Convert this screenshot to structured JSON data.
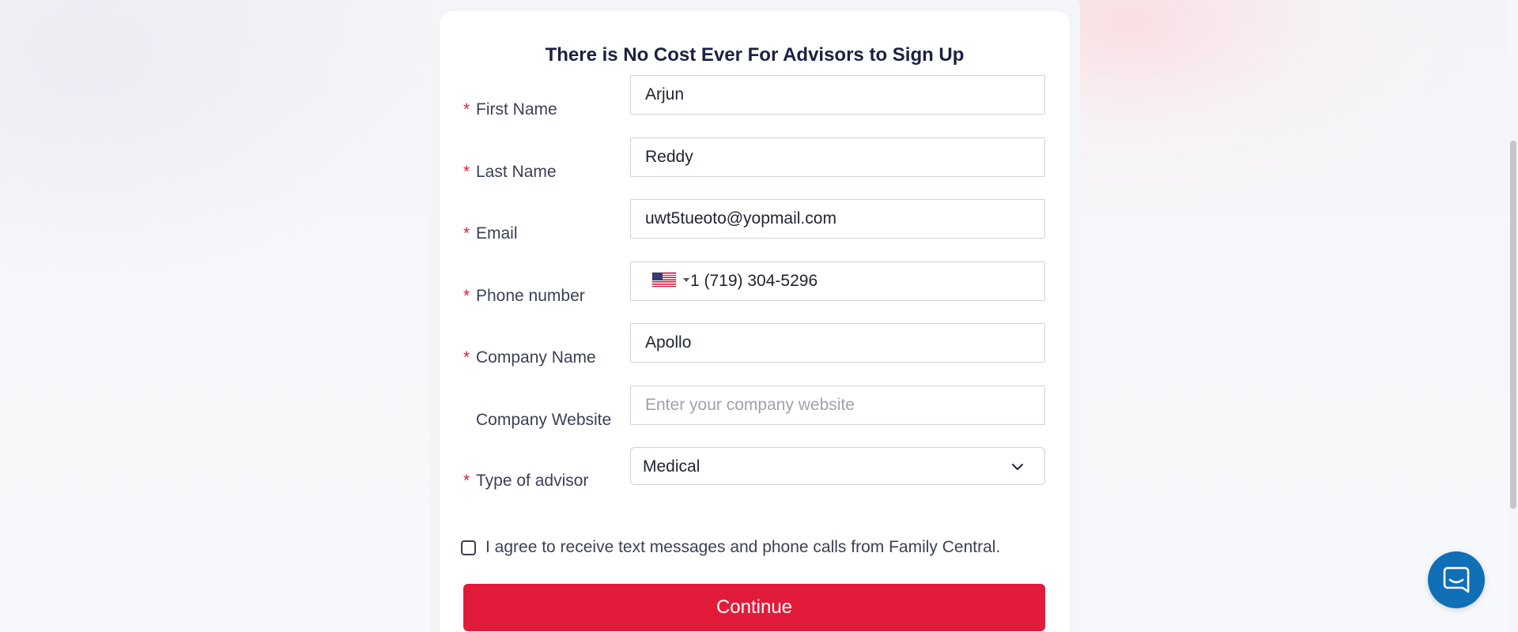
{
  "form": {
    "title": "There is No Cost Ever For Advisors to Sign Up",
    "required_marker": "*",
    "fields": {
      "first_name": {
        "label": "First Name",
        "value": "Arjun",
        "required": true
      },
      "last_name": {
        "label": "Last Name",
        "value": "Reddy",
        "required": true
      },
      "email": {
        "label": "Email",
        "value": "uwt5tueoto@yopmail.com",
        "required": true
      },
      "phone": {
        "label": "Phone number",
        "value": "1 (719) 304-5296",
        "country_flag": "us-flag-icon",
        "required": true
      },
      "company_name": {
        "label": "Company Name",
        "value": "Apollo",
        "required": true
      },
      "company_website": {
        "label": "Company Website",
        "value": "",
        "placeholder": "Enter your company website",
        "required": false
      },
      "advisor_type": {
        "label": "Type of advisor",
        "value": "Medical",
        "required": true
      }
    },
    "consent": {
      "text": "I agree to receive text messages and phone calls from Family Central.",
      "checked": false
    },
    "submit_label": "Continue"
  },
  "chat": {
    "icon": "chat-icon"
  },
  "colors": {
    "accent": "#e31b3b",
    "chat_button": "#0f6fb7",
    "title_text": "#1a2140",
    "label_text": "#3b4057"
  }
}
